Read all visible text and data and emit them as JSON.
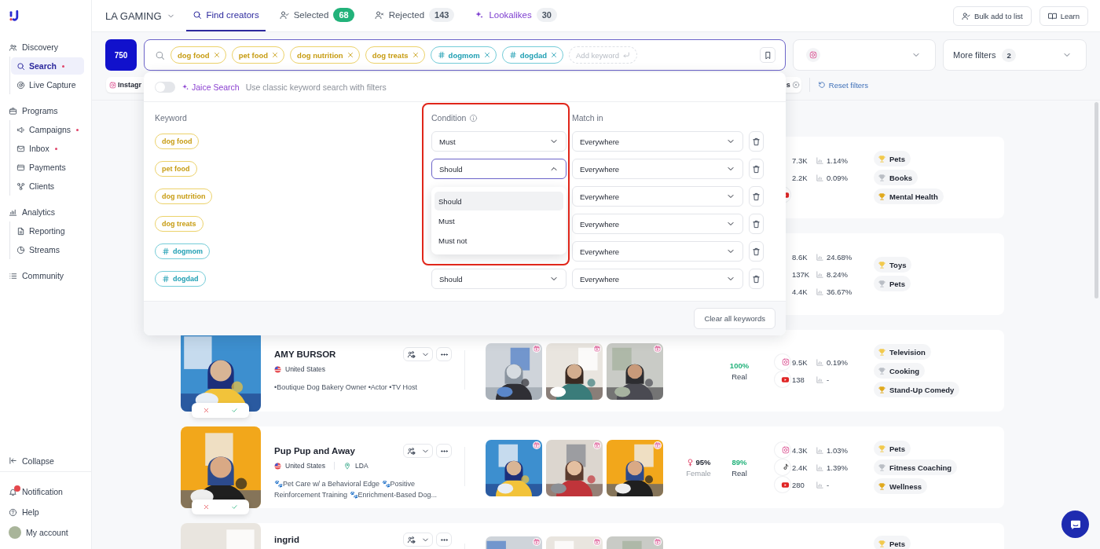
{
  "sidebar": {
    "sections": [
      {
        "label": "Discovery",
        "children": [
          {
            "label": "Search",
            "selected": true,
            "dot": true
          },
          {
            "label": "Live Capture",
            "selected": false,
            "dot": false
          }
        ]
      },
      {
        "label": "Programs",
        "children": [
          {
            "label": "Campaigns",
            "selected": false,
            "dot": true
          },
          {
            "label": "Inbox",
            "selected": false,
            "dot": true
          },
          {
            "label": "Payments",
            "selected": false,
            "dot": false
          },
          {
            "label": "Clients",
            "selected": false,
            "dot": false
          }
        ]
      },
      {
        "label": "Analytics",
        "children": [
          {
            "label": "Reporting",
            "selected": false,
            "dot": false
          },
          {
            "label": "Streams",
            "selected": false,
            "dot": false
          }
        ]
      },
      {
        "label": "Community"
      }
    ],
    "footer": [
      {
        "kind": "collapse",
        "label": "Collapse"
      },
      {
        "kind": "notification",
        "label": "Notification"
      },
      {
        "kind": "help",
        "label": "Help"
      },
      {
        "kind": "account",
        "label": "My account"
      }
    ]
  },
  "workspace": "LA GAMING",
  "tabs": [
    {
      "kind": "search",
      "label": "Find creators",
      "selected": true
    },
    {
      "kind": "selected",
      "label": "Selected",
      "selected": false,
      "count": "68",
      "color": "#22b27a"
    },
    {
      "kind": "rejected",
      "label": "Rejected",
      "selected": false,
      "count": "143",
      "color": "#eef0f3"
    },
    {
      "kind": "lookalikes",
      "label": "Lookalikes",
      "selected": false,
      "count": "30",
      "color": "#eef0f3"
    }
  ],
  "header_buttons": [
    {
      "kind": "bulk",
      "label": "Bulk add to list"
    },
    {
      "kind": "learn",
      "label": "Learn"
    }
  ],
  "filters": {
    "result_count": "750",
    "keywords": [
      {
        "kind": "keyword",
        "label": "dog food"
      },
      {
        "kind": "keyword",
        "label": "pet food"
      },
      {
        "kind": "keyword",
        "label": "dog nutrition"
      },
      {
        "kind": "keyword",
        "label": "dog treats"
      },
      {
        "kind": "hashtag",
        "label": "dogmom"
      },
      {
        "kind": "hashtag",
        "label": "dogdad"
      }
    ],
    "add_placeholder": "Add keyword",
    "more_filters": {
      "label": "More filters",
      "count": "2"
    },
    "chips": [
      {
        "kind": "instagram",
        "label": "Instagr"
      },
      {
        "kind": "removable",
        "label": "s"
      }
    ],
    "reset": "Reset filters"
  },
  "keyword_panel": {
    "toggle": {
      "on": false,
      "label": "Jaice Search",
      "hint": "Use classic keyword search with filters"
    },
    "columns": [
      "Keyword",
      "Condition",
      "Match in"
    ],
    "rows": [
      {
        "keyword": {
          "kind": "keyword",
          "label": "dog food"
        },
        "condition": "Must",
        "open": false,
        "match": "Everywhere"
      },
      {
        "keyword": {
          "kind": "keyword",
          "label": "pet food"
        },
        "condition": "Should",
        "open": true,
        "match": "Everywhere"
      },
      {
        "keyword": {
          "kind": "keyword",
          "label": "dog nutrition"
        },
        "match": "Everywhere"
      },
      {
        "keyword": {
          "kind": "keyword",
          "label": "dog treats"
        },
        "match": "Everywhere"
      },
      {
        "keyword": {
          "kind": "hashtag",
          "label": "dogmom"
        },
        "match": "Everywhere"
      },
      {
        "keyword": {
          "kind": "hashtag",
          "label": "dogdad"
        },
        "condition": "Should",
        "open": false,
        "match": "Everywhere"
      }
    ],
    "menu": [
      {
        "label": "Should",
        "selected": true
      },
      {
        "label": "Must",
        "selected": false
      },
      {
        "label": "Must not",
        "selected": false
      }
    ],
    "clear_button": "Clear all keywords"
  },
  "creators": [
    {
      "stats": [
        {
          "followers": "7.3K",
          "engagement": "1.14%"
        },
        {
          "followers": "2.2K",
          "engagement": "0.09%"
        },
        {
          "kind": "youtube"
        }
      ],
      "tags": [
        {
          "label": "Pets",
          "color": "#f2c94c"
        },
        {
          "label": "Books",
          "color": "#b9bdc4"
        },
        {
          "label": "Mental Health",
          "color": "#e0a91b"
        }
      ]
    },
    {
      "stats": [
        {
          "followers": "8.6K",
          "engagement": "24.68%"
        },
        {
          "followers": "137K",
          "engagement": "8.24%"
        },
        {
          "followers": "4.4K",
          "engagement": "36.67%"
        }
      ],
      "tags": [
        {
          "label": "Toys",
          "color": "#f2c94c"
        },
        {
          "label": "Pets",
          "color": "#b9bdc4"
        }
      ]
    },
    {
      "photo": {
        "kind": "picture"
      },
      "name": "AMY BURSOR",
      "country": "United States",
      "bio": "•Boutique Dog Bakery Owner •Actor •TV Host",
      "posts": [
        {
          "kind": "picture"
        },
        {
          "kind": "picture"
        },
        {
          "kind": "picture"
        }
      ],
      "audience": {
        "real": "100%",
        "real_label": "Real"
      },
      "stats": [
        {
          "kind": "instagram",
          "followers": "9.5K",
          "engagement": "0.19%"
        },
        {
          "kind": "youtube",
          "followers": "138",
          "engagement": "-"
        }
      ],
      "tags": [
        {
          "label": "Television",
          "color": "#f2c94c"
        },
        {
          "label": "Cooking",
          "color": "#b9bdc4"
        },
        {
          "label": "Stand-Up Comedy",
          "color": "#e0a91b"
        }
      ]
    },
    {
      "photo": {
        "kind": "picture"
      },
      "name": "Pup Pup and Away",
      "country": "United States",
      "location": "LDA",
      "bio": "🐾Pet Care w/ a Behavioral Edge 🐾Positive Reinforcement Training 🐾Enrichment-Based Dog...",
      "posts": [
        {
          "kind": "picture"
        },
        {
          "kind": "picture"
        },
        {
          "kind": "picture"
        }
      ],
      "audience": {
        "gender_share": "95%",
        "gender": "Female",
        "real": "89%",
        "real_label": "Real"
      },
      "stats": [
        {
          "kind": "instagram",
          "followers": "4.3K",
          "engagement": "1.03%"
        },
        {
          "kind": "tiktok",
          "followers": "2.4K",
          "engagement": "1.39%"
        },
        {
          "kind": "youtube",
          "followers": "280",
          "engagement": "-"
        }
      ],
      "tags": [
        {
          "label": "Pets",
          "color": "#f2c94c"
        },
        {
          "label": "Fitness Coaching",
          "color": "#b9bdc4"
        },
        {
          "label": "Wellness",
          "color": "#e0a91b"
        }
      ]
    },
    {
      "photo": {
        "kind": "picture"
      },
      "name": "ingrid",
      "posts": [
        {
          "kind": "picture"
        },
        {
          "kind": "picture"
        },
        {
          "kind": "picture"
        }
      ],
      "tags": [
        {
          "label": "Pets",
          "color": "#f2c94c"
        }
      ]
    }
  ]
}
